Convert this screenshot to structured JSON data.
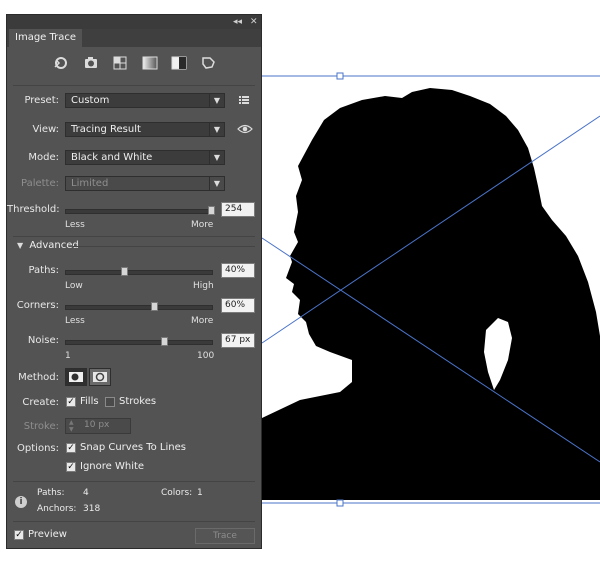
{
  "panel": {
    "title": "Image Trace",
    "collapse_glyph": "◂◂",
    "close_glyph": "✕",
    "preset_buttons": [
      "auto-color-icon",
      "high-color-icon",
      "low-color-icon",
      "grayscale-icon",
      "black-and-white-icon",
      "outline-icon"
    ]
  },
  "preset": {
    "label": "Preset:",
    "value": "Custom",
    "menu_icon": "list-icon"
  },
  "view": {
    "label": "View:",
    "value": "Tracing Result",
    "eye_icon": "eye-icon"
  },
  "mode": {
    "label": "Mode:",
    "value": "Black and White"
  },
  "palette": {
    "label": "Palette:",
    "value": "Limited"
  },
  "threshold": {
    "label": "Threshold:",
    "value": "254",
    "min_label": "Less",
    "max_label": "More",
    "level": 0.99
  },
  "advanced": {
    "label": "Advanced",
    "expanded": true
  },
  "paths": {
    "label": "Paths:",
    "value": "40%",
    "min_label": "Low",
    "max_label": "High",
    "level": 0.4
  },
  "corners": {
    "label": "Corners:",
    "value": "60%",
    "min_label": "Less",
    "max_label": "More",
    "level": 0.6
  },
  "noise": {
    "label": "Noise:",
    "value": "67 px",
    "min_label": "1",
    "max_label": "100",
    "level": 0.67
  },
  "method": {
    "label": "Method:"
  },
  "create": {
    "label": "Create:",
    "fills": "Fills",
    "fills_checked": true,
    "strokes": "Strokes",
    "strokes_checked": false
  },
  "stroke": {
    "label": "Stroke:",
    "value": "10 px"
  },
  "options": {
    "label": "Options:",
    "snap": "Snap Curves To Lines",
    "snap_checked": true,
    "ignore": "Ignore White",
    "ignore_checked": true
  },
  "stats": {
    "paths_label": "Paths:",
    "paths_value": "4",
    "colors_label": "Colors:",
    "colors_value": "1",
    "anchors_label": "Anchors:",
    "anchors_value": "318"
  },
  "footer": {
    "preview": "Preview",
    "preview_checked": true,
    "trace": "Trace"
  },
  "colors": {
    "panel_bg": "#535353",
    "selection_blue": "#4a73c8",
    "silhouette": "#000000"
  }
}
